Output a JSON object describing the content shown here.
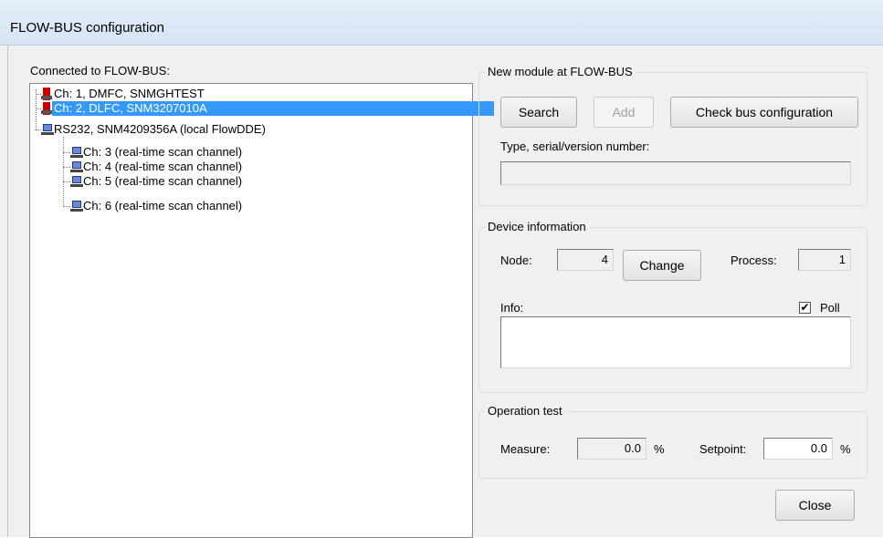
{
  "window": {
    "title": "FLOW-BUS configuration"
  },
  "tree": {
    "label": "Connected to FLOW-BUS:",
    "items": [
      {
        "text": "Ch: 1, DMFC, SNMGHTEST",
        "icon": "flow-device-icon",
        "selected": false
      },
      {
        "text": "Ch: 2, DLFC, SNM3207010A",
        "icon": "flow-device-icon",
        "selected": true
      },
      {
        "text": "RS232, SNM4209356A (local FlowDDE)",
        "icon": "computer-icon",
        "selected": false
      },
      {
        "text": "Ch: 3 (real-time scan channel)",
        "icon": "computer-icon",
        "selected": false
      },
      {
        "text": "Ch: 4 (real-time scan channel)",
        "icon": "computer-icon",
        "selected": false
      },
      {
        "text": "Ch: 5 (real-time scan channel)",
        "icon": "computer-icon",
        "selected": false
      },
      {
        "text": "Ch: 6 (real-time scan channel)",
        "icon": "computer-icon",
        "selected": false
      }
    ]
  },
  "new_module": {
    "caption": "New module at FLOW-BUS",
    "search_label": "Search",
    "add_label": "Add",
    "check_label": "Check bus configuration",
    "type_label": "Type, serial/version number:",
    "type_value": ""
  },
  "device_info": {
    "caption": "Device information",
    "node_label": "Node:",
    "node_value": "4",
    "change_label": "Change",
    "process_label": "Process:",
    "process_value": "1",
    "info_label": "Info:",
    "poll_label": "Poll",
    "poll_checked": true,
    "info_value": ""
  },
  "operation_test": {
    "caption": "Operation test",
    "measure_label": "Measure:",
    "measure_value": "0.0",
    "measure_unit": "%",
    "setpoint_label": "Setpoint:",
    "setpoint_value": "0.0",
    "setpoint_unit": "%"
  },
  "close_label": "Close",
  "colors": {
    "selection": "#3399ff",
    "window_bg": "#f0f0f0",
    "device_icon": "#cc0000"
  }
}
